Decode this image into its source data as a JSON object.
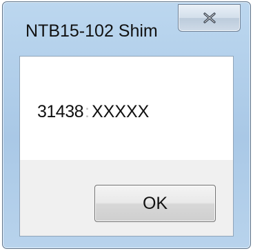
{
  "window": {
    "title": "NTB15-102 Shim",
    "close_icon": "close-icon"
  },
  "dialog": {
    "message_code": "31438",
    "message_value": "XXXXX",
    "separator": ":"
  },
  "buttons": {
    "ok_label": "OK"
  }
}
